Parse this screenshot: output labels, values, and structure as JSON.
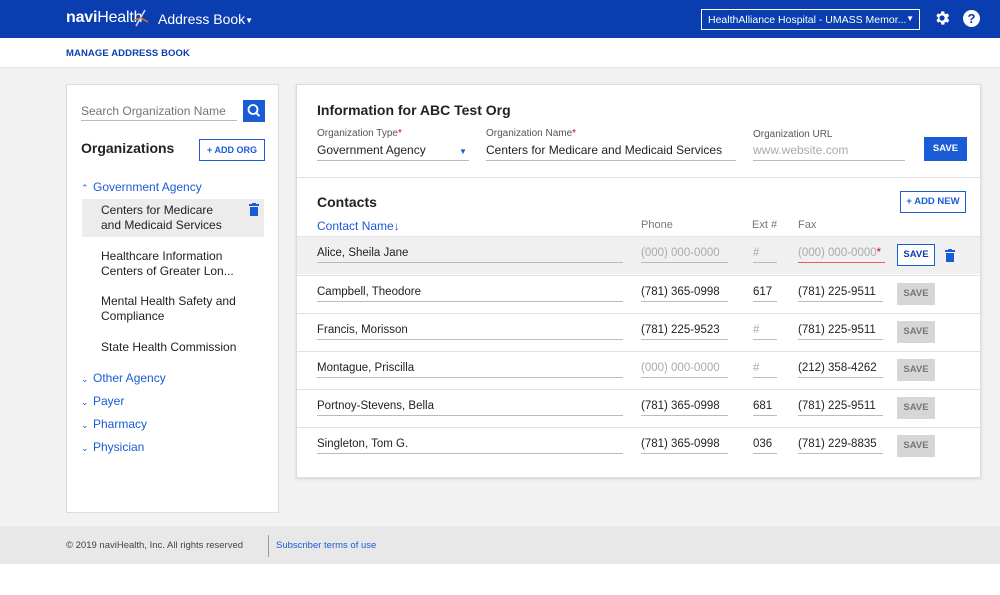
{
  "header": {
    "logo_bold": "navi",
    "logo_regular": "Health",
    "app_title": "Address Book",
    "hospital": "HealthAlliance Hospital - UMASS Memor...",
    "help_glyph": "?",
    "gear_icon": "gear-icon",
    "brand_color": "#0a3eb0"
  },
  "subhead": {
    "title": "MANAGE ADDRESS BOOK"
  },
  "sidebar": {
    "search_placeholder": "Search Organization Name",
    "title": "Organizations",
    "add_org_label": "+ ADD ORG",
    "groups": [
      {
        "label": "Government Agency",
        "expanded": true
      },
      {
        "label": "Other Agency",
        "expanded": false
      },
      {
        "label": "Payer",
        "expanded": false
      },
      {
        "label": "Pharmacy",
        "expanded": false
      },
      {
        "label": "Physician",
        "expanded": false
      }
    ],
    "orgs": [
      {
        "line1": "Centers for Medicare",
        "line2": "and Medicaid Services",
        "selected": true
      },
      {
        "line1": "Healthcare Information",
        "line2": "Centers of Greater Lon..."
      },
      {
        "line1": "Mental Health Safety and",
        "line2": "Compliance"
      },
      {
        "line1": "State Health Commission",
        "line2": ""
      }
    ]
  },
  "info": {
    "title": "Information for ABC Test Org",
    "org_type_label": "Organization Type",
    "org_type_value": "Government Agency",
    "org_name_label": "Organization Name",
    "org_name_value": "Centers for Medicare and Medicaid Services",
    "org_url_label": "Organization URL",
    "org_url_placeholder": "www.website.com",
    "save_label": "SAVE",
    "required_mark": "*"
  },
  "contacts": {
    "title": "Contacts",
    "add_new_label": "+ ADD NEW",
    "columns": {
      "name": "Contact Name",
      "phone": "Phone",
      "ext": "Ext #",
      "fax": "Fax"
    },
    "sort_arrow": "↓",
    "save_label": "SAVE",
    "rows": [
      {
        "name": "Alice, Sheila Jane",
        "phone": "(000) 000-0000",
        "ext": "#",
        "fax": "(000) 000-0000",
        "phone_ph": true,
        "ext_ph": true,
        "fax_ph": true,
        "active": true
      },
      {
        "name": "Campbell, Theodore",
        "phone": "(781) 365-0998",
        "ext": "617",
        "fax": "(781) 225-9511"
      },
      {
        "name": "Francis, Morisson",
        "phone": "(781) 225-9523",
        "ext": "#",
        "fax": "(781) 225-9511",
        "ext_ph": true
      },
      {
        "name": "Montague, Priscilla",
        "phone": "(000) 000-0000",
        "ext": "#",
        "fax": "(212) 358-4262",
        "phone_ph": true,
        "ext_ph": true
      },
      {
        "name": "Portnoy-Stevens, Bella",
        "phone": "(781) 365-0998",
        "ext": "681",
        "fax": "(781) 225-9511"
      },
      {
        "name": "Singleton, Tom G.",
        "phone": "(781) 365-0998",
        "ext": "036",
        "fax": "(781) 229-8835"
      }
    ]
  },
  "footer": {
    "copyright": "© 2019 naviHealth, Inc. All rights reserved",
    "terms": "Subscriber terms of use"
  }
}
